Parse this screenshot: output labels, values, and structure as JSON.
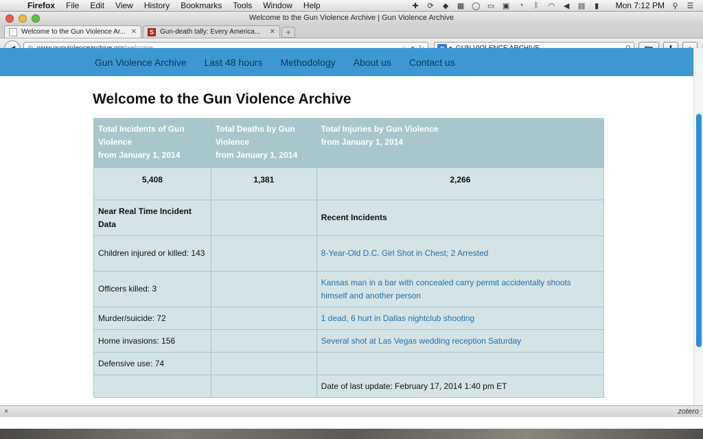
{
  "menubar": {
    "app": "Firefox",
    "items": [
      "File",
      "Edit",
      "View",
      "History",
      "Bookmarks",
      "Tools",
      "Window",
      "Help"
    ],
    "clock": "Mon 7:12 PM"
  },
  "window": {
    "title": "Welcome to the Gun Violence Archive | Gun Violence Archive",
    "tabs": [
      {
        "title": "Welcome to the Gun Violence Ar...",
        "active": true
      },
      {
        "title": "Gun-death tally: Every America...",
        "active": false
      }
    ],
    "new_tab": "+"
  },
  "navbar": {
    "url_domain": "www.gunviolencearchive.org",
    "url_path": "/welcome",
    "search_value": "GUN VIOLENCE ARCHIVE"
  },
  "site_nav": [
    "Gun Violence Archive",
    "Last 48 hours",
    "Methodology",
    "About us",
    "Contact us"
  ],
  "page_title": "Welcome to the Gun Violence Archive",
  "totals": {
    "incidents_label": "Total Incidents of Gun Violence",
    "incidents_since": "from January 1, 2014",
    "incidents_value": "5,408",
    "deaths_label": "Total Deaths by Gun Violence",
    "deaths_since": "from January 1, 2014",
    "deaths_value": "1,381",
    "injuries_label": "Total Injuries by Gun Violence",
    "injuries_since": "from January 1, 2014",
    "injuries_value": "2,266"
  },
  "realtime_heading": "Near Real Time Incident Data",
  "recent_heading": "Recent Incidents",
  "stats": [
    "Children injured or killed: 143",
    "Officers killed: 3",
    "Murder/suicide: 72",
    "Home invasions: 156",
    "Defensive use: 74"
  ],
  "incidents": [
    "8-Year-Old D.C. Girl Shot in Chest; 2 Arrested",
    "Kansas man in a bar with concealed carry permit accidentally shoots himself and another person",
    "1 dead, 6 hurt in Dallas nightclub shooting",
    "Several shot at Las Vegas wedding reception Saturday"
  ],
  "last_update": "Date of last update: February 17, 2014 1:40 pm ET",
  "statusbar": {
    "close": "×",
    "zotero": "zotero"
  },
  "colors": {
    "site_nav_bg": "#3d97d3",
    "table_header": "#a8c7cc",
    "table_cell": "#d4e4e6",
    "link": "#1f6fb0"
  }
}
